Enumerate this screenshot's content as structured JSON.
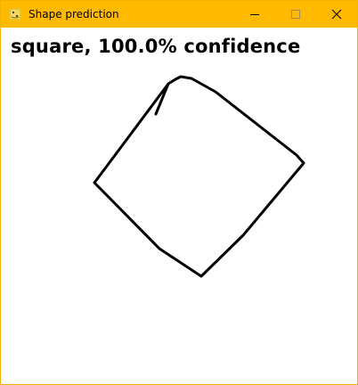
{
  "window": {
    "title": "Shape prediction",
    "app_icon": "python-icon",
    "accent": "#ffba00",
    "controls": {
      "minimize_icon": "minimize-icon",
      "maximize_icon": "maximize-icon",
      "close_icon": "close-icon"
    }
  },
  "prediction": {
    "text": "square, 100.0% confidence"
  },
  "drawing": {
    "shape_description": "hand-drawn square outline",
    "stroke_color": "#000000"
  }
}
